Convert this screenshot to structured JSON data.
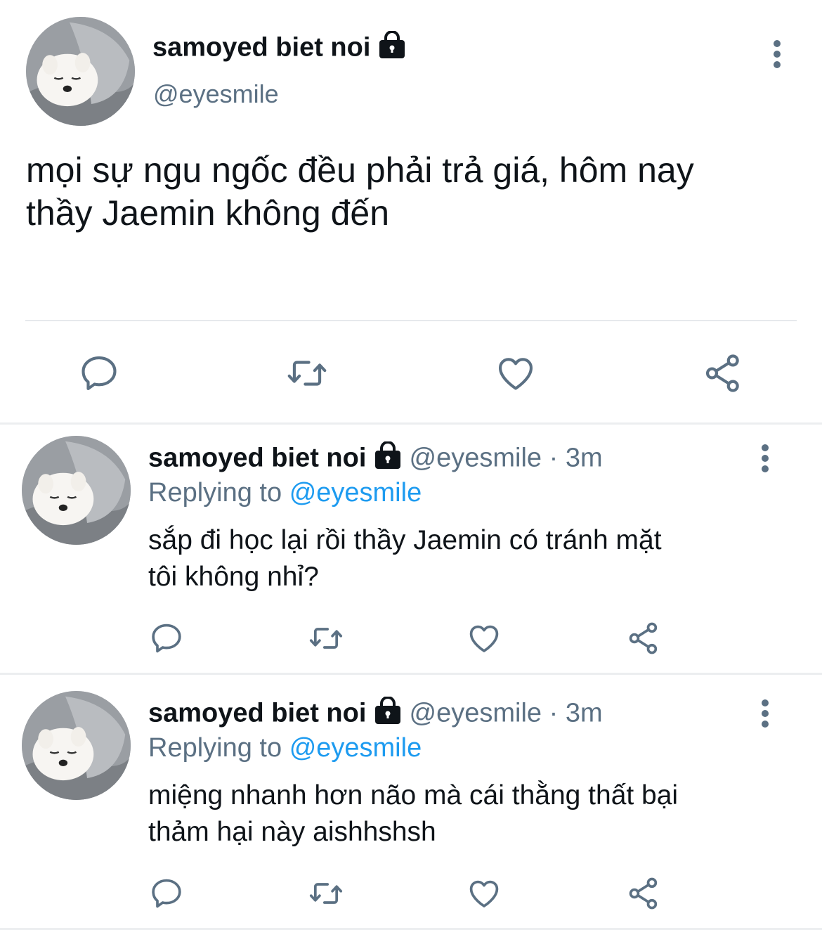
{
  "main_tweet": {
    "display_name": "samoyed biet noi",
    "handle": "@eyesmile",
    "text_line1": "mọi sự ngu ngốc đều phải trả giá, hôm nay",
    "text_line2": "thầy Jaemin không đến"
  },
  "replies": [
    {
      "display_name": "samoyed biet noi",
      "handle": "@eyesmile",
      "separator": "·",
      "time": "3m",
      "replying_label": "Replying to",
      "replying_handle": "@eyesmile",
      "text_line1": "sắp đi học lại rồi thầy Jaemin có tránh mặt",
      "text_line2": "tôi không nhỉ?"
    },
    {
      "display_name": "samoyed biet noi",
      "handle": "@eyesmile",
      "separator": "·",
      "time": "3m",
      "replying_label": "Replying to",
      "replying_handle": "@eyesmile",
      "text_line1": "miệng nhanh hơn não mà cái thằng thất bại",
      "text_line2": "thảm hại này aishhshsh"
    }
  ],
  "icons": [
    "lock-icon",
    "more-icon",
    "reply-icon",
    "retweet-icon",
    "like-icon",
    "share-icon"
  ],
  "colors": {
    "text": "#0f1419",
    "secondary": "#5b7083",
    "link": "#1d9bf0",
    "divider": "#eceef0"
  }
}
